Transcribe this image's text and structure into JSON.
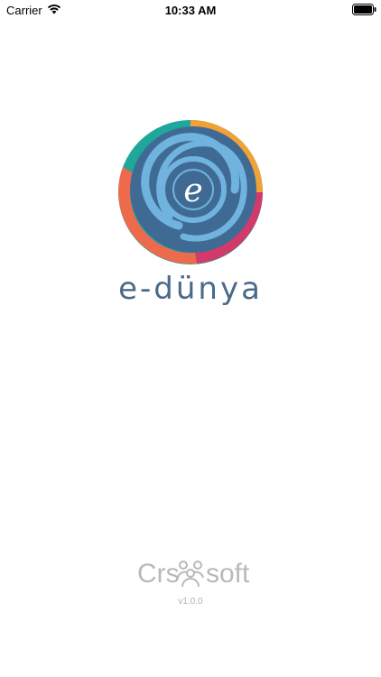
{
  "status_bar": {
    "carrier": "Carrier",
    "time": "10:33 AM",
    "wifi_icon": "wifi-icon",
    "battery_icon": "battery-icon"
  },
  "app": {
    "brand_name": "e-dünya",
    "logo_icon": "e-dunya-logo",
    "logo_letter": "e"
  },
  "footer": {
    "company_part1": "Crs",
    "company_part2": "soft",
    "company_icon": "people-icon",
    "version": "v1.0.0"
  },
  "colors": {
    "brand_blue": "#4a6a8a",
    "swirl_dark": "#3f6a94",
    "swirl_light": "#6fb3de",
    "teal": "#1fa79b",
    "orange": "#f1a136",
    "magenta": "#d23a6c",
    "coral": "#ee6a4c",
    "footer_gray": "#b9b9b9"
  }
}
